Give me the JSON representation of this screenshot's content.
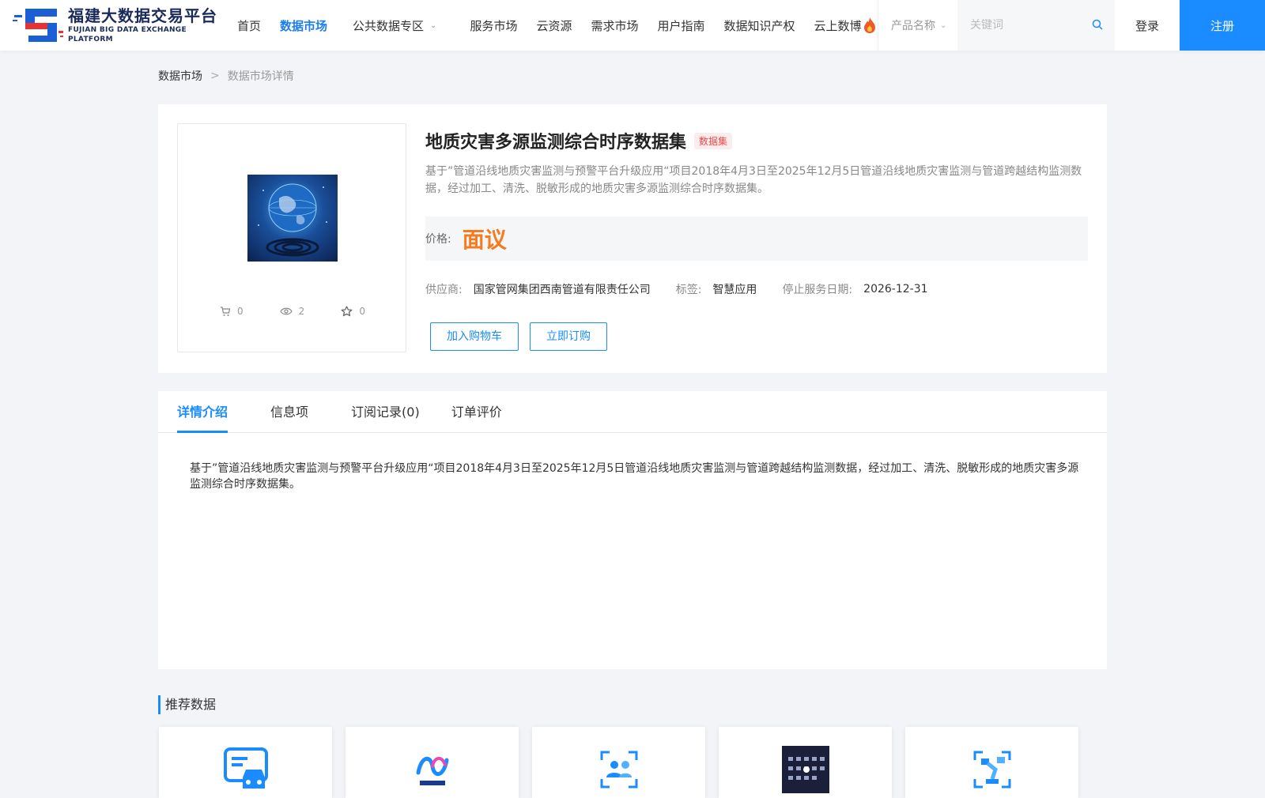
{
  "header": {
    "logo_cn": "福建大数据交易平台",
    "logo_en": "FUJIAN BIG DATA EXCHANGE  PLATFORM",
    "nav": [
      {
        "label": "首页"
      },
      {
        "label": "数据市场"
      },
      {
        "label": "公共数据专区"
      },
      {
        "label": "服务市场"
      },
      {
        "label": "云资源"
      },
      {
        "label": "需求市场"
      },
      {
        "label": "用户指南"
      },
      {
        "label": "数据知识产权"
      },
      {
        "label": "云上数博"
      }
    ],
    "search_select": "产品名称",
    "search_placeholder": "关键词",
    "login": "登录",
    "register": "注册",
    "accent": "#1a8cff"
  },
  "breadcrumb": {
    "home": "数据市场",
    "sep": ">",
    "current": "数据市场详情"
  },
  "product": {
    "title": "地质灾害多源监测综合时序数据集",
    "badge": "数据集",
    "desc": "基于”管道沿线地质灾害监测与预警平台升级应用“项目2018年4月3日至2025年12月5日管道沿线地质灾害监测与管道跨越结构监测数据，经过加工、清洗、脱敏形成的地质灾害多源监测综合时序数据集。",
    "price_label": "价格:",
    "price_value": "面议",
    "supplier_label": "供应商:",
    "supplier": "国家管网集团西南管道有限责任公司",
    "tag_label": "标签:",
    "tag": "智慧应用",
    "stop_label": "停止服务日期:",
    "stop_date": "2026-12-31",
    "stats": {
      "cart": "0",
      "views": "2",
      "stars": "0"
    },
    "btn_cart": "加入购物车",
    "btn_buy": "立即订购",
    "price_color": "#f57b20"
  },
  "tabs": [
    {
      "label": "详情介绍"
    },
    {
      "label": "信息项"
    },
    {
      "label": "订阅记录(0)"
    },
    {
      "label": "订单评价"
    }
  ],
  "detail_text": "基于”管道沿线地质灾害监测与预警平台升级应用“项目2018年4月3日至2025年12月5日管道沿线地质灾害监测与管道跨越结构监测数据，经过加工、清洗、脱敏形成的地质灾害多源监测综合时序数据集。",
  "recommend": {
    "title": "推荐数据",
    "items": [
      {
        "icon": "car-card-icon"
      },
      {
        "icon": "brand-logo-icon"
      },
      {
        "icon": "user-scan-icon"
      },
      {
        "icon": "keyboard-image-icon"
      },
      {
        "icon": "robot-arm-icon"
      }
    ]
  }
}
